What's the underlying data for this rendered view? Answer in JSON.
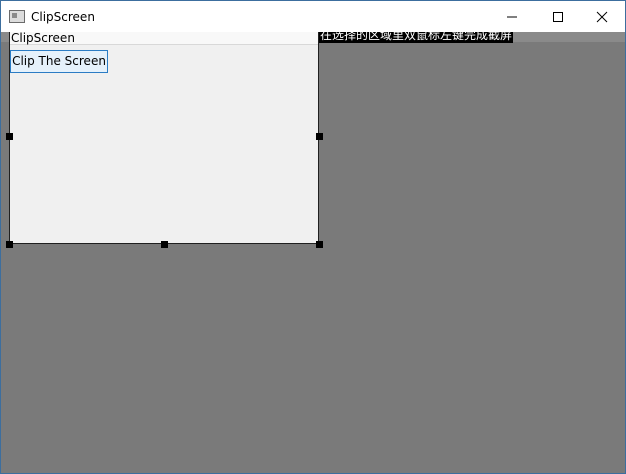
{
  "window": {
    "title": "ClipScreen",
    "controls": {
      "minimize": "minimize",
      "maximize": "maximize",
      "close": "close"
    }
  },
  "selection": {
    "title": "ClipScreen",
    "button_label": "Clip The Screen"
  },
  "hint": {
    "text": "在选择的区域里双鼠标左键完成截屏"
  },
  "colors": {
    "overlay": "#7a7a7a",
    "selection_border": "#202020",
    "button_border": "#2b7cc4",
    "hint_background": "#000000",
    "hint_text": "#ffffff"
  }
}
